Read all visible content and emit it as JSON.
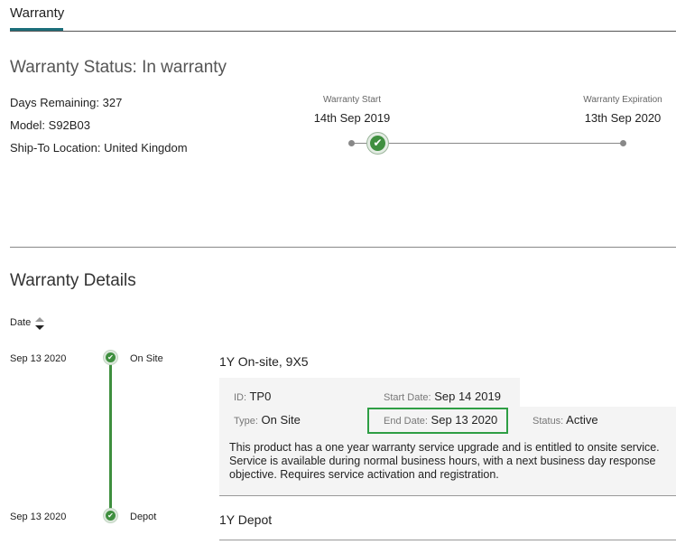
{
  "tabs": {
    "active_label": "Warranty"
  },
  "status": {
    "title": "Warranty Status: In warranty",
    "days_remaining_label": "Days Remaining:",
    "days_remaining_value": "327",
    "model_label": "Model:",
    "model_value": "S92B03",
    "location_label": "Ship-To Location:",
    "location_value": "United Kingdom"
  },
  "timeline": {
    "start_label": "Warranty Start",
    "start_date": "14th Sep 2019",
    "end_label": "Warranty Expiration",
    "end_date": "13th Sep 2020",
    "check_icon": "check-icon",
    "accent_color": "#3f8f3f"
  },
  "details": {
    "title": "Warranty Details",
    "sort_label": "Date",
    "rows": [
      {
        "date": "Sep 13 2020",
        "type": "On Site",
        "title": "1Y On-site, 9X5",
        "id_label": "ID:",
        "id_value": "TP0",
        "start_label": "Start Date:",
        "start_value": "Sep 14 2019",
        "type_label": "Type:",
        "type_value": "On Site",
        "end_label": "End Date:",
        "end_value": "Sep 13 2020",
        "status_label": "Status:",
        "status_value": "Active",
        "description": "This product has a one year warranty service upgrade and is entitled to onsite service. Service is available during normal business hours, with a next business day response objective. Requires service activation and registration."
      },
      {
        "date": "Sep 13 2020",
        "type": "Depot",
        "title": "1Y Depot"
      }
    ]
  }
}
